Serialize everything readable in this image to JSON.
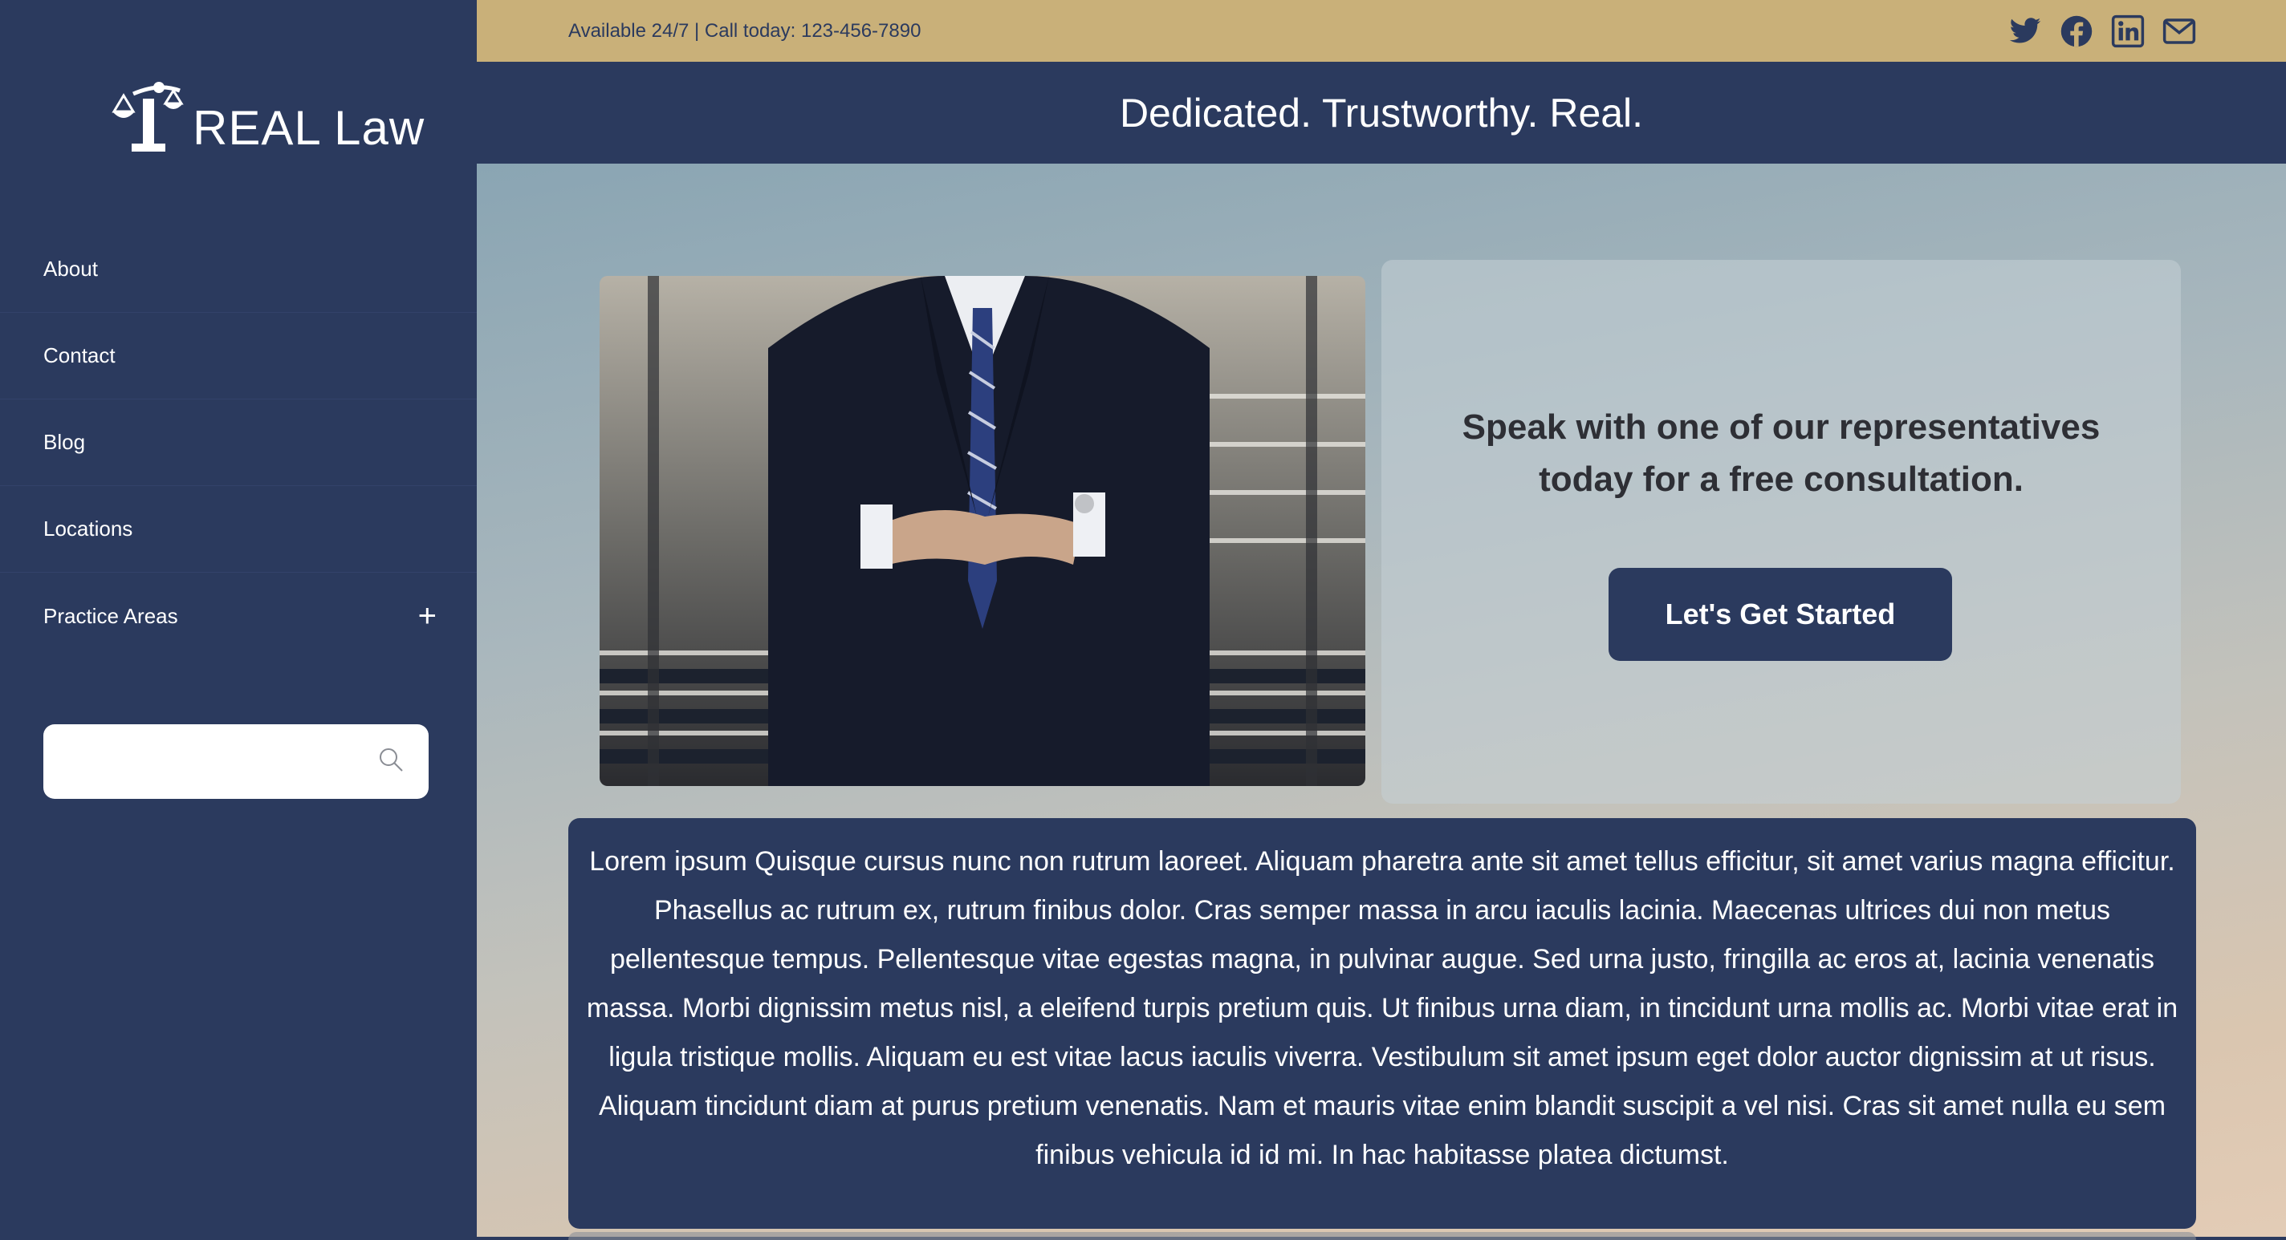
{
  "brand": {
    "name": "REAL Law",
    "logo_icon": "scales-of-justice-icon"
  },
  "sidebar": {
    "items": [
      {
        "label": "About"
      },
      {
        "label": "Contact"
      },
      {
        "label": "Blog"
      },
      {
        "label": "Locations"
      },
      {
        "label": "Practice Areas",
        "expand_icon": "plus-icon",
        "expand_glyph": "+"
      }
    ],
    "search": {
      "placeholder": "",
      "value": "",
      "icon": "search-icon"
    }
  },
  "topbar": {
    "contact_text": "Available 24/7 | Call today: 123-456-7890",
    "social_icons": [
      "twitter-icon",
      "facebook-icon",
      "linkedin-icon",
      "email-icon"
    ]
  },
  "header": {
    "tagline": "Dedicated. Trustworthy. Real."
  },
  "hero": {
    "image": "businessman-in-suit-on-stairs",
    "cta_heading": "Speak with one of our representatives today for a free consultation.",
    "cta_button": "Let's Get Started",
    "body_text": "Lorem ipsum Quisque cursus nunc non rutrum laoreet. Aliquam pharetra ante sit amet tellus efficitur, sit amet varius magna efficitur. Phasellus ac rutrum ex, rutrum finibus dolor. Cras semper massa in arcu iaculis lacinia. Maecenas ultrices dui non metus pellentesque tempus. Pellentesque vitae egestas magna, in pulvinar augue. Sed urna justo, fringilla ac eros at, lacinia venenatis massa. Morbi dignissim metus nisl, a eleifend turpis pretium quis. Ut finibus urna diam, in tincidunt urna mollis ac. Morbi vitae erat in ligula tristique mollis. Aliquam eu est vitae lacus iaculis viverra. Vestibulum sit amet ipsum eget dolor auctor dignissim at ut risus. Aliquam tincidunt diam at purus pretium venenatis. Nam et mauris vitae enim blandit suscipit a vel nisi. Cras sit amet nulla eu sem finibus vehicula id id mi. In hac habitasse platea dictumst."
  },
  "colors": {
    "navy": "#2b3a5e",
    "gold": "#c9b079",
    "card_text": "#2e2f35"
  }
}
